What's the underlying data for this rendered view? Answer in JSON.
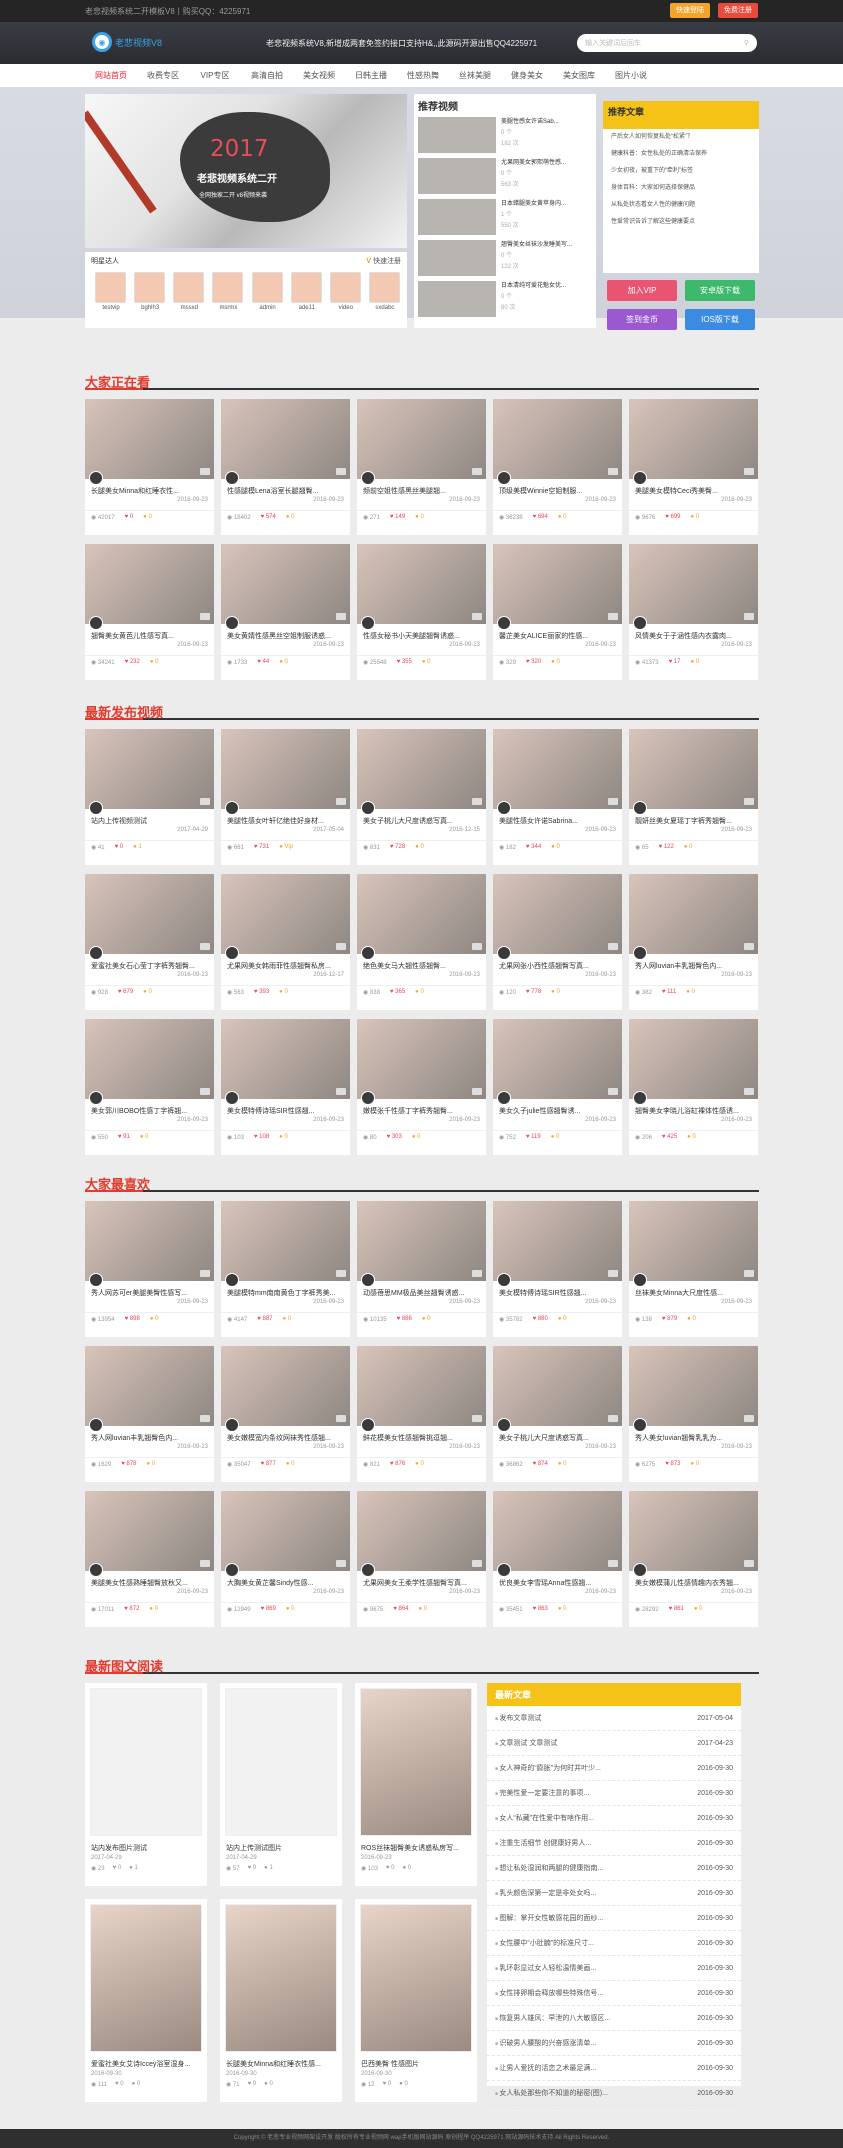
{
  "topbar": {
    "text": "老悲视频系统二开模板V8丨购买QQ：4225971",
    "btn_login": "快速登陆",
    "btn_register": "免费注册"
  },
  "header": {
    "logo": "老悲视频V8",
    "notice": "老悲视频系统V8,新增成两套免签约接口支持H&,,此源码开源出售QQ4225971",
    "search_placeholder": "输入关键词后回车"
  },
  "nav": [
    "网站首页",
    "收费专区",
    "VIP专区",
    "高清自拍",
    "美女视频",
    "日韩主播",
    "性感热舞",
    "丝袜美腿",
    "健身美女",
    "美女图库",
    "图片小说"
  ],
  "banner": {
    "year": "2017",
    "title": "老悲视频系统二开",
    "sub": "全网独家二开 v8视频来袭"
  },
  "friends": {
    "title": "明星达人",
    "register": "快速注册",
    "users": [
      "testvip",
      "bghlh3",
      "mssxd",
      "msrmx",
      "admin",
      "ade11",
      "video",
      "sxdabc"
    ]
  },
  "recommend": {
    "title": "推荐视频",
    "items": [
      {
        "title": "美腿性感女许诺Sab...",
        "v": "0 个",
        "n": "182 次"
      },
      {
        "title": "尤果网美女郭熙萌性感...",
        "v": "0 个",
        "n": "563 次"
      },
      {
        "title": "日本蜡腿美女黄苹身内...",
        "v": "1 个",
        "n": "550 次"
      },
      {
        "title": "翘臀美女丝袜沙发睡美写...",
        "v": "0 个",
        "n": "122 次"
      },
      {
        "title": "日本清纯可爱花魁女优...",
        "v": "0 个",
        "n": "80 次"
      }
    ]
  },
  "hot": {
    "title": "推荐文章",
    "items": [
      "产后女人如何恢复私处“松紧”？",
      "健康科普：女性私处的正确清洁保养",
      "少女初夜，被重下的“牵利”标签",
      "身体百科：大家如何选择保健品",
      "从私处状态看女人性的健康问题",
      "性爱常识告诉了解这些健康要点"
    ]
  },
  "quick": [
    {
      "label": "加入VIP",
      "color": "#e85472"
    },
    {
      "label": "安卓版下载",
      "color": "#3db86c"
    },
    {
      "label": "签到金币",
      "color": "#9b59d0"
    },
    {
      "label": "IOS版下载",
      "color": "#3b8be0"
    }
  ],
  "sections": {
    "watching": "大家正在看",
    "latest": "最新发布视频",
    "favorite": "大家最喜欢",
    "articles": "最新图文阅读"
  },
  "watching": [
    {
      "t": "长腿美女Minna和红睡衣性...",
      "d": "2016-09-23",
      "v": "42017",
      "h": "0",
      "c": "0"
    },
    {
      "t": "性感腿模Lena浴室长腿翘臀...",
      "d": "2016-09-23",
      "v": "18402",
      "h": "574",
      "c": "0"
    },
    {
      "t": "频前空姐性感黑丝美腿翘...",
      "d": "2016-09-23",
      "v": "271",
      "h": "149",
      "c": "0"
    },
    {
      "t": "顶级美模Winnie空姐制服...",
      "d": "2016-09-23",
      "v": "36238",
      "h": "694",
      "c": "0"
    },
    {
      "t": "美腿美女模特Ceci秀美臀...",
      "d": "2016-09-23",
      "v": "9676",
      "h": "699",
      "c": "0"
    },
    {
      "t": "翘臀美女黄芭儿性感写真...",
      "d": "2016-09-23",
      "v": "34241",
      "h": "232",
      "c": "0"
    },
    {
      "t": "美女黄婧性感黑丝空姐制服诱惑...",
      "d": "2016-09-23",
      "v": "1733",
      "h": "44",
      "c": "0"
    },
    {
      "t": "性感女秘书小天美腿翘臀诱惑...",
      "d": "2016-09-23",
      "v": "25548",
      "h": "355",
      "c": "0"
    },
    {
      "t": "馨芷美女ALICE丽家的性感...",
      "d": "2016-09-23",
      "v": "329",
      "h": "320",
      "c": "0"
    },
    {
      "t": "风情美女于子涵性感内衣露肉...",
      "d": "2016-09-23",
      "v": "41373",
      "h": "17",
      "c": "0"
    }
  ],
  "latest": [
    {
      "t": "站内上传视频测试",
      "d": "2017-04-29",
      "v": "41",
      "h": "0",
      "c": "1"
    },
    {
      "t": "美腿性感女叶轩亿绝佳好身材...",
      "d": "2017-05-04",
      "v": "661",
      "h": "731",
      "c": "Vip"
    },
    {
      "t": "美女子桃儿大尺度诱惑写真...",
      "d": "2016-12-15",
      "v": "831",
      "h": "728",
      "c": "0"
    },
    {
      "t": "美腿性感女许诺Sabrina...",
      "d": "2016-09-23",
      "v": "182",
      "h": "344",
      "c": "0"
    },
    {
      "t": "靓妍丝美女夏瑶丁字裤秀翘臀...",
      "d": "2016-09-23",
      "v": "65",
      "h": "122",
      "c": "0"
    },
    {
      "t": "爱蜜社美女石心莹丁字裤秀翘臀...",
      "d": "2016-09-23",
      "v": "928",
      "h": "679",
      "c": "0"
    },
    {
      "t": "尤果网美女韩雨菲性感翘臀私房...",
      "d": "2016-12-17",
      "v": "563",
      "h": "393",
      "c": "0"
    },
    {
      "t": "绝色美女马大翘性感翘臀...",
      "d": "2016-09-23",
      "v": "838",
      "h": "365",
      "c": "0"
    },
    {
      "t": "尤果网张小西性感翘臀写真...",
      "d": "2016-09-23",
      "v": "120",
      "h": "778",
      "c": "0"
    },
    {
      "t": "秀人网luvian丰乳翘臀色内...",
      "d": "2016-09-23",
      "v": "382",
      "h": "111",
      "c": "0"
    },
    {
      "t": "美女郭川BOBO性感丁字裤翘...",
      "d": "2016-09-23",
      "v": "550",
      "h": "91",
      "c": "0"
    },
    {
      "t": "美女模特傅诗瑶SIR性感翘...",
      "d": "2016-09-23",
      "v": "103",
      "h": "108",
      "c": "0"
    },
    {
      "t": "嫩模张千性感丁字裤秀翘臀...",
      "d": "2016-09-23",
      "v": "80",
      "h": "303",
      "c": "0"
    },
    {
      "t": "美女久子julie性感翘臀诱...",
      "d": "2016-09-23",
      "v": "752",
      "h": "119",
      "c": "0"
    },
    {
      "t": "翘臀美女李晓儿浴缸裸体性感诱...",
      "d": "2016-09-23",
      "v": "206",
      "h": "425",
      "c": "0"
    }
  ],
  "favorite": [
    {
      "t": "秀人网苏可er美腿美臀性感写...",
      "d": "2016-09-23",
      "v": "13954",
      "h": "898",
      "c": "0"
    },
    {
      "t": "美腿模特mm南南黄色丁字裤秀美...",
      "d": "2016-09-23",
      "v": "4147",
      "h": "887",
      "c": "0"
    },
    {
      "t": "动感蓓思MM极品美丝翘臀诱惑...",
      "d": "2016-09-23",
      "v": "10135",
      "h": "886",
      "c": "0"
    },
    {
      "t": "美女模特傅诗瑶SIR性感翘...",
      "d": "2016-09-23",
      "v": "35782",
      "h": "880",
      "c": "0"
    },
    {
      "t": "丝袜美女Minna大尺度性感...",
      "d": "2016-09-23",
      "v": "138",
      "h": "879",
      "c": "0"
    },
    {
      "t": "秀人网luvian丰乳翘臀色内...",
      "d": "2016-09-23",
      "v": "1629",
      "h": "878",
      "c": "0"
    },
    {
      "t": "美女嫩模宽内条纹网袜秀性感翘...",
      "d": "2016-09-23",
      "v": "35047",
      "h": "877",
      "c": "0"
    },
    {
      "t": "鲜花模美女性感翘臀挑逗翘...",
      "d": "2016-09-23",
      "v": "821",
      "h": "876",
      "c": "0"
    },
    {
      "t": "美女子桃儿大尺度诱惑写真...",
      "d": "2016-09-23",
      "v": "36862",
      "h": "874",
      "c": "0"
    },
    {
      "t": "秀人美女luvian翘臀乳乳为...",
      "d": "2016-09-23",
      "v": "6275",
      "h": "873",
      "c": "0"
    },
    {
      "t": "美腿美女性感熟睡翘臀放秋又...",
      "d": "2016-09-23",
      "v": "17011",
      "h": "872",
      "c": "0"
    },
    {
      "t": "大胸美女黄芷馨Sindy性感...",
      "d": "2016-09-23",
      "v": "12949",
      "h": "869",
      "c": "0"
    },
    {
      "t": "尤果网美女王柔学性感翘臀写真...",
      "d": "2016-09-23",
      "v": "9675",
      "h": "864",
      "c": "0"
    },
    {
      "t": "优良美女李雪瑶Anna性感翘...",
      "d": "2016-09-23",
      "v": "35451",
      "h": "863",
      "c": "0"
    },
    {
      "t": "美女嫩模蒲儿性感情趣内衣秀翘...",
      "d": "2016-09-23",
      "v": "28292",
      "h": "861",
      "c": "0"
    }
  ],
  "articles": [
    {
      "t": "站内发布图片测试",
      "d": "2017-04-29",
      "v": "23",
      "h": "0",
      "c": "1",
      "img": false
    },
    {
      "t": "站内上传测试图片",
      "d": "2017-04-29",
      "v": "57",
      "h": "0",
      "c": "1",
      "img": false
    },
    {
      "t": "ROS丝袜翘臀美女诱惑私房写...",
      "d": "2016-09-23",
      "v": "103",
      "h": "0",
      "c": "0",
      "img": true
    },
    {
      "t": "爱蜜社美女艾诗Iccey浴室湿身...",
      "d": "2016-09-30",
      "v": "111",
      "h": "0",
      "c": "0",
      "img": true
    },
    {
      "t": "长腿美女Minna和红睡衣性感...",
      "d": "2016-09-30",
      "v": "71",
      "h": "0",
      "c": "0",
      "img": true
    },
    {
      "t": "巴西美臀 性感图片",
      "d": "2016-09-30",
      "v": "12",
      "h": "0",
      "c": "0",
      "img": true
    }
  ],
  "newest": {
    "title": "最新文章",
    "items": [
      {
        "t": "发布文章测试",
        "d": "2017-05-04"
      },
      {
        "t": "文章测试 文章测试",
        "d": "2017-04-23"
      },
      {
        "t": "女人神奇的“膨胀”为何时并叶少...",
        "d": "2016-09-30"
      },
      {
        "t": "完美性爱一定要注意的事项...",
        "d": "2016-09-30"
      },
      {
        "t": "女人“私藏”在性爱中有啥作用...",
        "d": "2016-09-30"
      },
      {
        "t": "注重生活细节 创健康好男人...",
        "d": "2016-09-30"
      },
      {
        "t": "想让私处湿润和两腿的健康指南...",
        "d": "2016-09-30"
      },
      {
        "t": "乳头颜色深第一定是非处女吗...",
        "d": "2016-09-30"
      },
      {
        "t": "图解：掌开女性敏感花园的面纱...",
        "d": "2016-09-30"
      },
      {
        "t": "女性腰中“小肚腩”的标准尺寸...",
        "d": "2016-09-30"
      },
      {
        "t": "乳环彰显过女人轻松温情美画...",
        "d": "2016-09-30"
      },
      {
        "t": "女性排卵期会释放哪些特殊信号...",
        "d": "2016-09-30"
      },
      {
        "t": "恢复男人雄风：早泄的八大敏感区...",
        "d": "2016-09-30"
      },
      {
        "t": "识破男人腰酸的兴奋感涨清单...",
        "d": "2016-09-30"
      },
      {
        "t": "让男人爱抚的活恋之术最足满...",
        "d": "2016-09-30"
      },
      {
        "t": "女人私处那些你不知道的秘密(图)...",
        "d": "2016-09-30"
      }
    ]
  },
  "footer": "Copyright © 老悲专业视频网架设开发 版权所有专业视频网 wap手机版网站源码 原创程序 QQ4225971 网站源码技术支持 All Rights Reserved."
}
